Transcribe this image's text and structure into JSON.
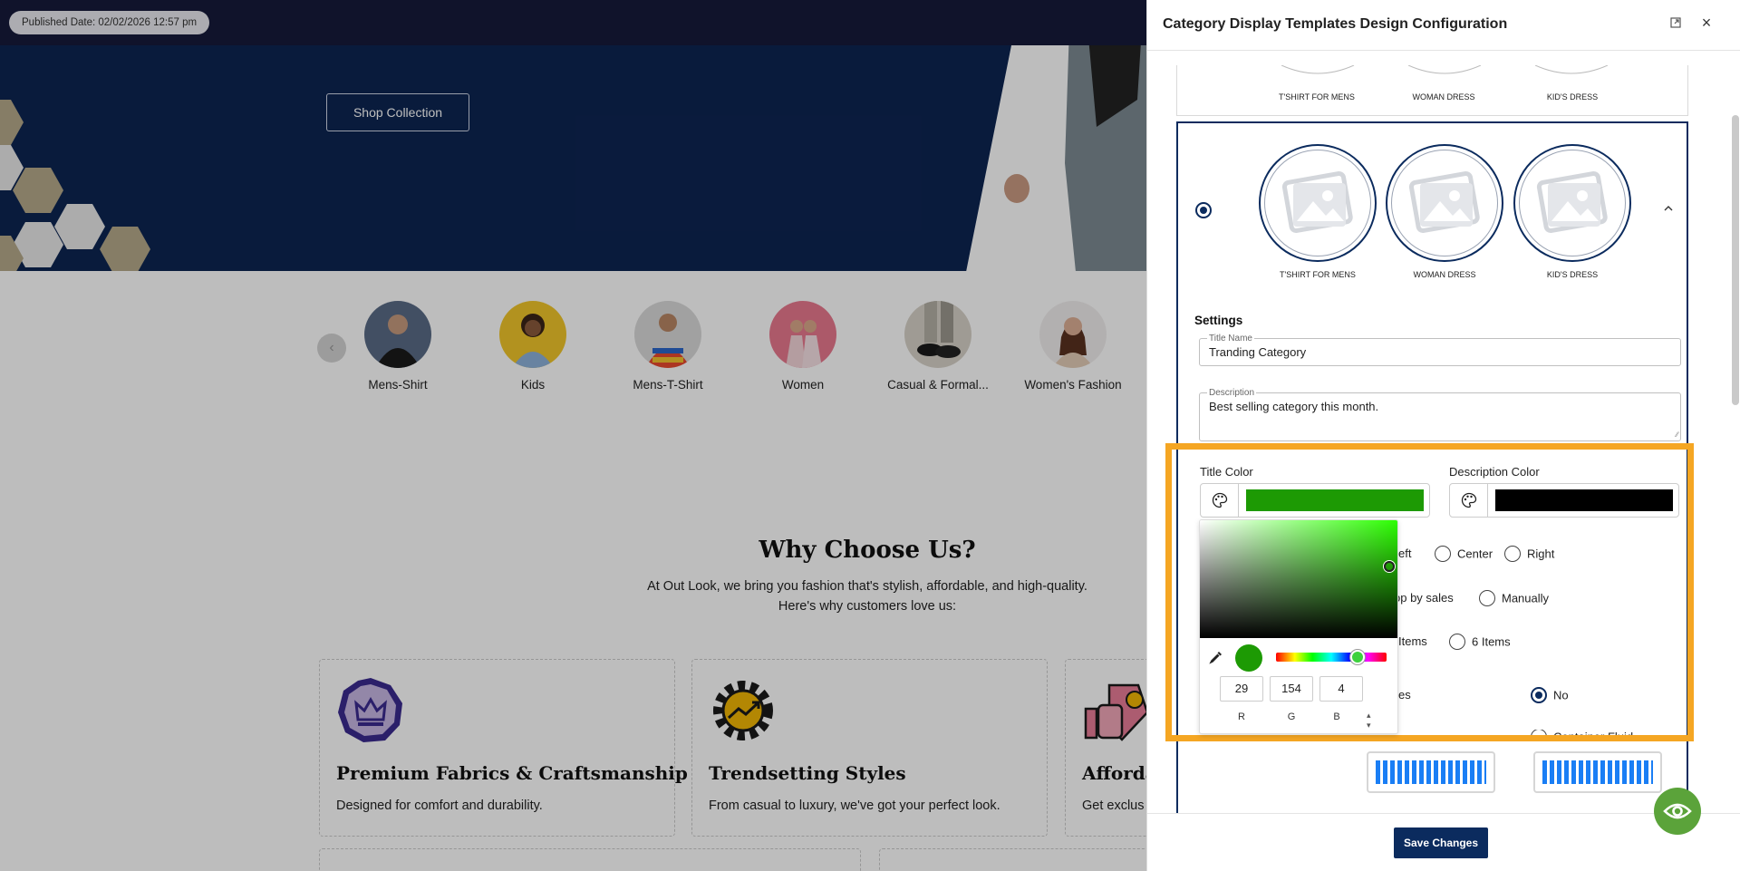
{
  "published": "Published Date: 02/02/2026 12:57 pm",
  "hero": {
    "button": "Shop Collection"
  },
  "categories": [
    {
      "label": "Mens-Shirt"
    },
    {
      "label": "Kids"
    },
    {
      "label": "Mens-T-Shirt"
    },
    {
      "label": "Women"
    },
    {
      "label": "Casual & Formal..."
    },
    {
      "label": "Women's Fashion"
    }
  ],
  "why": {
    "title": "Why Choose Us?",
    "line1": "At Out Look, we bring you fashion that's stylish, affordable, and high-quality.",
    "line2": "Here's why customers love us:",
    "cards": [
      {
        "title": "Premium Fabrics & Craftsmanship",
        "text": "Designed for comfort and durability."
      },
      {
        "title": "Trendsetting Styles",
        "text": "From casual to luxury, we've got your perfect look."
      },
      {
        "title": "Afforda",
        "text": "Get exclus"
      }
    ]
  },
  "panel": {
    "title": "Category Display Templates Design Configuration",
    "template_labels": [
      "T'SHIRT FOR MENS",
      "WOMAN DRESS",
      "KID'S DRESS"
    ],
    "settings_heading": "Settings",
    "title_name": {
      "legend": "Title Name",
      "value": "Tranding Category"
    },
    "description": {
      "legend": "Description",
      "value": "Best selling category this month."
    },
    "title_color": {
      "label": "Title Color",
      "color": "#1d9a04"
    },
    "description_color": {
      "label": "Description Color",
      "color": "#000000"
    },
    "alignment": {
      "partial": "eft",
      "options": [
        "Center",
        "Right"
      ]
    },
    "sort": {
      "partial": "op by sales",
      "option": "Manually"
    },
    "items": {
      "partial": "Items",
      "option": "6 Items"
    },
    "toggle": {
      "partial": "es",
      "option": "No"
    },
    "container": {
      "partial": "Container Fluid"
    },
    "save": "Save Changes"
  },
  "picker": {
    "r": "29",
    "g": "154",
    "b": "4",
    "r_label": "R",
    "g_label": "G",
    "b_label": "B",
    "preview": "#1d9a04"
  },
  "colors": {
    "navy": "#0b2b5e",
    "highlight": "#f5a623",
    "hero": "#0d2552"
  }
}
